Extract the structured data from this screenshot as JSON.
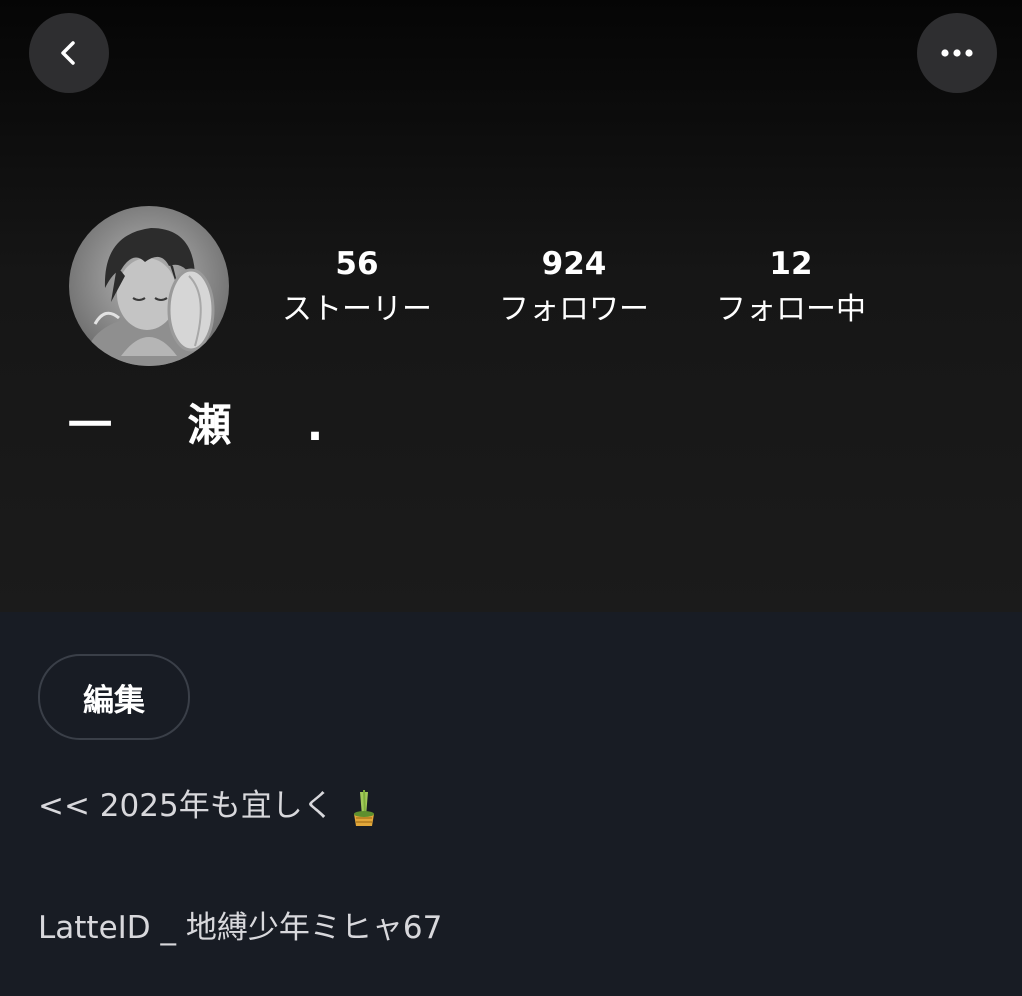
{
  "nav": {
    "back_icon": "chevron-left-icon",
    "more_icon": "more-horizontal-icon"
  },
  "profile": {
    "username": "一 瀬 .",
    "avatar_icon": "avatar-illustration",
    "stats": {
      "stories": {
        "count": "56",
        "label": "ストーリー"
      },
      "followers": {
        "count": "924",
        "label": "フォロワー"
      },
      "following": {
        "count": "12",
        "label": "フォロー中"
      }
    }
  },
  "actions": {
    "edit_label": "編集"
  },
  "bio": {
    "line1": "<< 2025年も宜しく",
    "line1_emoji": "kadomatsu-emoji",
    "line2": "LatteID _ 地縛少年ミヒャ67"
  },
  "colors": {
    "header_bg": "#161616",
    "body_bg": "#181c24",
    "button_bg": "#2e2e30",
    "text_primary": "#ffffff",
    "text_secondary": "#d8d8dc"
  }
}
